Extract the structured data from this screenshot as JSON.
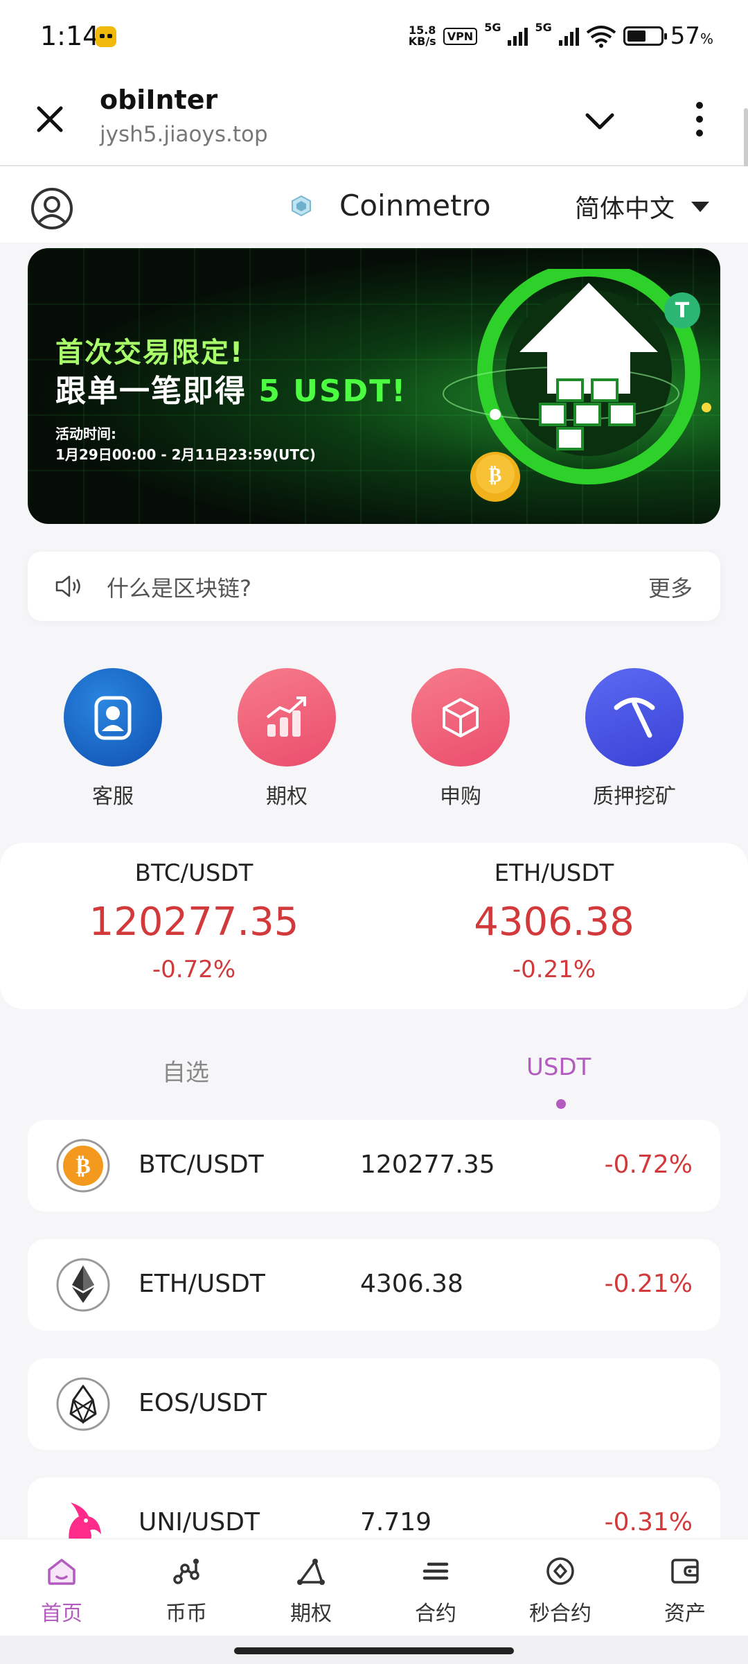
{
  "status_bar": {
    "time": "1:14",
    "net_speed_top": "15.8",
    "net_speed_bottom": "KB/s",
    "vpn": "VPN",
    "net1": "5G",
    "net2": "5G",
    "battery": "57",
    "battery_unit": "%"
  },
  "browser": {
    "title": "obiInter",
    "url": "jysh5.jiaoys.top"
  },
  "header": {
    "brand": "Coinmetro",
    "language": "简体中文"
  },
  "banner": {
    "line1": "首次交易限定!",
    "line2_prefix": "跟单一笔即得 ",
    "line2_highlight": "5 USDT!",
    "line3": "活动时间:",
    "line4": "1月29日00:00 - 2月11日23:59(UTC)"
  },
  "notice": {
    "text": "什么是区块链?",
    "more": "更多"
  },
  "quick_actions": [
    {
      "label": "客服",
      "color": "#1a63c4"
    },
    {
      "label": "期权",
      "color": "#f2617a"
    },
    {
      "label": "申购",
      "color": "#f2617a"
    },
    {
      "label": "质押挖矿",
      "color": "#4753e8"
    }
  ],
  "ticker": [
    {
      "pair": "BTC/USDT",
      "price": "120277.35",
      "change": "-0.72%"
    },
    {
      "pair": "ETH/USDT",
      "price": "4306.38",
      "change": "-0.21%"
    }
  ],
  "tabs": {
    "favorites": "自选",
    "usdt": "USDT",
    "active": "usdt",
    "active_color": "#b45bc0"
  },
  "market": [
    {
      "pair": "BTC/USDT",
      "price": "120277.35",
      "change": "-0.72%",
      "icon": "bitcoin-icon"
    },
    {
      "pair": "ETH/USDT",
      "price": "4306.38",
      "change": "-0.21%",
      "icon": "ethereum-icon"
    },
    {
      "pair": "EOS/USDT",
      "price": "",
      "change": "",
      "icon": "eos-icon"
    },
    {
      "pair": "UNI/USDT",
      "price": "7.719",
      "change": "-0.31%",
      "icon": "uniswap-icon"
    }
  ],
  "nav": [
    {
      "label": "首页",
      "icon": "home-icon",
      "active": true
    },
    {
      "label": "币币",
      "icon": "nodes-icon"
    },
    {
      "label": "期权",
      "icon": "triangle-icon"
    },
    {
      "label": "合约",
      "icon": "list-icon"
    },
    {
      "label": "秒合约",
      "icon": "diamond-icon"
    },
    {
      "label": "资产",
      "icon": "wallet-icon"
    }
  ],
  "colors": {
    "negative": "#d2393b",
    "accent": "#b45bc0"
  }
}
